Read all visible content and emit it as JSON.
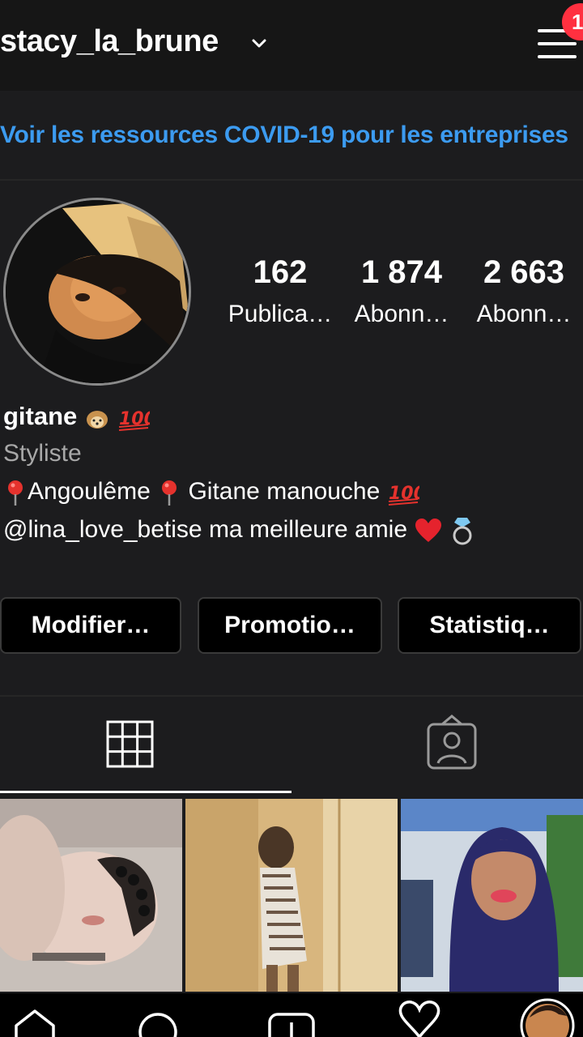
{
  "header": {
    "username": "stacy_la_brune",
    "notification_count": "1",
    "chevron_icon": "chevron-down-icon",
    "menu_icon": "hamburger-menu-icon"
  },
  "banner": {
    "text": "Voir les ressources COVID-19 pour les entreprises"
  },
  "profile": {
    "stats": [
      {
        "value": "162",
        "label": "Publica…"
      },
      {
        "value": "1 874",
        "label": "Abonn…"
      },
      {
        "value": "2 663",
        "label": "Abonn…"
      }
    ],
    "display_name": "gitane",
    "category": "Styliste",
    "bio_line1": {
      "part1": "Angoulême",
      "part2": "Gitane manouche"
    },
    "bio_line2": "@lina_love_betise ma meilleure amie"
  },
  "buttons": {
    "edit": "Modifier…",
    "promote": "Promotio…",
    "insights": "Statistiq…"
  },
  "tabs": [
    {
      "icon": "grid-icon",
      "selected": true
    },
    {
      "icon": "tagged-person-icon",
      "selected": false
    }
  ],
  "bottom_nav": [
    "home-icon",
    "search-icon",
    "add-post-icon",
    "heart-icon",
    "profile-avatar"
  ],
  "colors": {
    "background": "#1c1c1e",
    "link_blue": "#3c9bf0",
    "badge_red": "#ff3040"
  }
}
